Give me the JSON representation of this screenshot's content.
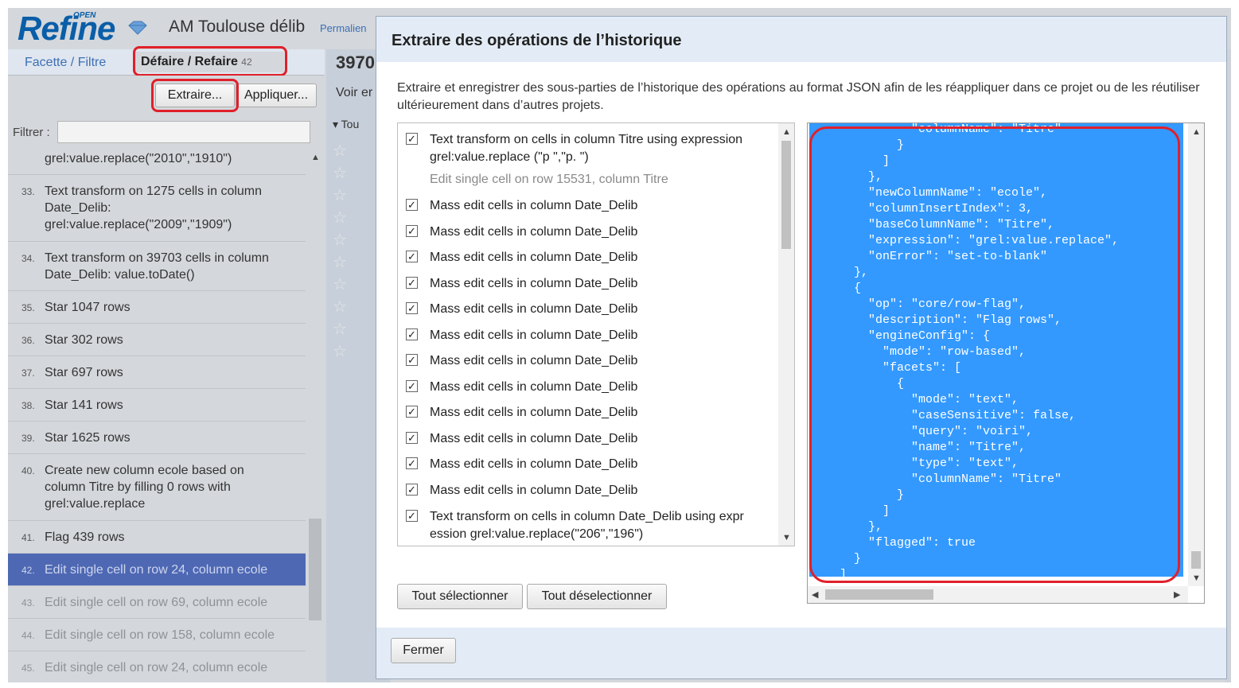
{
  "header": {
    "logo_text": "Refine",
    "logo_badge": "OPEN",
    "project_title": "AM Toulouse délib",
    "permalink": "Permalien"
  },
  "left_panel": {
    "tab_facet": "Facette / Filtre",
    "tab_undo": "Défaire / Refaire",
    "tab_undo_count": "42",
    "extract_button": "Extraire...",
    "apply_button": "Appliquer...",
    "filter_label": "Filtrer :",
    "filter_value": "",
    "history": [
      {
        "num": "",
        "text": "grel:value.replace(\"2010\",\"1910\")"
      },
      {
        "num": "33.",
        "text": "Text transform on 1275 cells in column Date_Delib: grel:value.replace(\"2009\",\"1909\")"
      },
      {
        "num": "34.",
        "text": "Text transform on 39703 cells in column Date_Delib: value.toDate()"
      },
      {
        "num": "35.",
        "text": "Star 1047 rows"
      },
      {
        "num": "36.",
        "text": "Star 302 rows"
      },
      {
        "num": "37.",
        "text": "Star 697 rows"
      },
      {
        "num": "38.",
        "text": "Star 141 rows"
      },
      {
        "num": "39.",
        "text": "Star 1625 rows"
      },
      {
        "num": "40.",
        "text": "Create new column ecole based on column Titre by filling 0 rows with grel:value.replace"
      },
      {
        "num": "41.",
        "text": "Flag 439 rows"
      },
      {
        "num": "42.",
        "text": "Edit single cell on row 24, column ecole"
      },
      {
        "num": "43.",
        "text": "Edit single cell on row 69, column ecole"
      },
      {
        "num": "44.",
        "text": "Edit single cell on row 158, column ecole"
      },
      {
        "num": "45.",
        "text": "Edit single cell on row 24, column ecole"
      }
    ]
  },
  "data_area": {
    "rows_count": "3970",
    "view_label": "Voir er",
    "all_column": "Tou"
  },
  "dialog": {
    "title": "Extraire des opérations de l’historique",
    "description": "Extraire et enregistrer des sous-parties de l’historique des opérations au format JSON afin de les réappliquer dans ce projet ou de les réutiliser ultérieurement dans d’autres projets.",
    "operations": [
      {
        "text": "Text transform on cells in column Titre using expression grel:value.replace (\"p \",\"p. \")",
        "checked": true
      },
      {
        "text": "Edit single cell on row 15531, column Titre",
        "checked": false
      },
      {
        "text": "Mass edit cells in column Date_Delib",
        "checked": true
      },
      {
        "text": "Mass edit cells in column Date_Delib",
        "checked": true
      },
      {
        "text": "Mass edit cells in column Date_Delib",
        "checked": true
      },
      {
        "text": "Mass edit cells in column Date_Delib",
        "checked": true
      },
      {
        "text": "Mass edit cells in column Date_Delib",
        "checked": true
      },
      {
        "text": "Mass edit cells in column Date_Delib",
        "checked": true
      },
      {
        "text": "Mass edit cells in column Date_Delib",
        "checked": true
      },
      {
        "text": "Mass edit cells in column Date_Delib",
        "checked": true
      },
      {
        "text": "Mass edit cells in column Date_Delib",
        "checked": true
      },
      {
        "text": "Mass edit cells in column Date_Delib",
        "checked": true
      },
      {
        "text": "Mass edit cells in column Date_Delib",
        "checked": true
      },
      {
        "text": "Mass edit cells in column Date_Delib",
        "checked": true
      },
      {
        "text": "Text transform on cells in column Date_Delib using expr ession grel:value.replace(\"206\",\"196\")",
        "checked": true
      }
    ],
    "select_all_button": "Tout sélectionner",
    "deselect_all_button": "Tout déselectionner",
    "close_button": "Fermer",
    "json_text": "            \"columnName\": \"Titre\"\n          }\n        ]\n      },\n      \"newColumnName\": \"ecole\",\n      \"columnInsertIndex\": 3,\n      \"baseColumnName\": \"Titre\",\n      \"expression\": \"grel:value.replace\",\n      \"onError\": \"set-to-blank\"\n    },\n    {\n      \"op\": \"core/row-flag\",\n      \"description\": \"Flag rows\",\n      \"engineConfig\": {\n        \"mode\": \"row-based\",\n        \"facets\": [\n          {\n            \"mode\": \"text\",\n            \"caseSensitive\": false,\n            \"query\": \"voiri\",\n            \"name\": \"Titre\",\n            \"type\": \"text\",\n            \"columnName\": \"Titre\"\n          }\n        ]\n      },\n      \"flagged\": true\n    }\n  ]"
  },
  "colors": {
    "annotation_ring": "#e0202a",
    "selection": "#3399ff",
    "current_history": "#4e68b3",
    "logo": "#0a5ea8"
  }
}
